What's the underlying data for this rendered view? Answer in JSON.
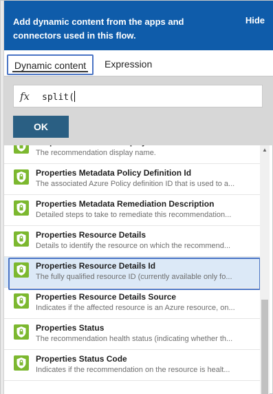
{
  "header": {
    "message": "Add dynamic content from the apps and connectors used in this flow.",
    "hide_label": "Hide"
  },
  "tabs": [
    {
      "label": "Dynamic content",
      "active": true
    },
    {
      "label": "Expression",
      "active": false
    }
  ],
  "expression": {
    "fx_symbol": "fx",
    "value": "split(",
    "ok_label": "OK"
  },
  "items": [
    {
      "title": "Properties Metadata Display Name",
      "desc": "The recommendation display name."
    },
    {
      "title": "Properties Metadata Policy Definition Id",
      "desc": "The associated Azure Policy definition ID that is used to a..."
    },
    {
      "title": "Properties Metadata Remediation Description",
      "desc": "Detailed steps to take to remediate this recommendation..."
    },
    {
      "title": "Properties Resource Details",
      "desc": "Details to identify the resource on which the recommend..."
    },
    {
      "title": "Properties Resource Details Id",
      "desc": "The fully qualified resource ID (currently available only fo..."
    },
    {
      "title": "Properties Resource Details Source",
      "desc": "Indicates if the affected resource is an Azure resource, on..."
    },
    {
      "title": "Properties Status",
      "desc": "The recommendation health status (indicating whether th..."
    },
    {
      "title": "Properties Status Code",
      "desc": "Indicates if the recommendation on the resource is healt..."
    }
  ],
  "selected_index": 4,
  "colors": {
    "header_bg": "#0f5caa",
    "ok_button_bg": "#2a5f83",
    "icon_green": "#7cb82f",
    "highlight_border": "#4a74c4",
    "selected_row_bg": "#dce9f7"
  }
}
